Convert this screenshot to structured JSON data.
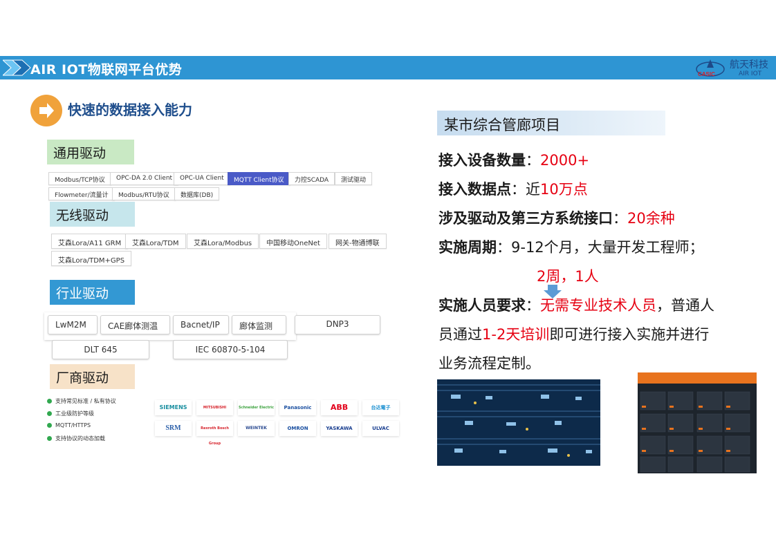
{
  "header": {
    "title": "AIR IOT物联网平台优势",
    "logo_cn": "航天科技",
    "logo_en": "AIR IOT",
    "logo_mark": "CASIC"
  },
  "section": {
    "title": "快速的数据接入能力"
  },
  "general": {
    "title": "通用驱动",
    "tags": [
      "Modbus/TCP协议",
      "OPC-DA 2.0 Client",
      "OPC-UA Client",
      "MQTT Client协议",
      "力控SCADA",
      "测试驱动",
      "Flowmeter/流量计",
      "Modbus/RTU协议",
      "数据库(DB)"
    ]
  },
  "wireless": {
    "title": "无线驱动",
    "tags": [
      "艾森Lora/A11 GRM",
      "艾森Lora/TDM",
      "艾森Lora/Modbus",
      "中国移动OneNet",
      "网关-物通博联",
      "艾森Lora/TDM+GPS"
    ]
  },
  "industry": {
    "title": "行业驱动",
    "tags": [
      "LwM2M",
      "CAE廊体测温",
      "Bacnet/IP",
      "廊体监测",
      "DNP3",
      "DLT 645",
      "IEC 60870-5-104"
    ]
  },
  "vendor": {
    "title": "厂商驱动",
    "features": [
      "支持常见标准 / 私有协议",
      "工业级防护等级",
      "MQTT/HTTPS",
      "支持协议的动态加载"
    ],
    "brands": [
      "SIEMENS",
      "MITSUBISHI ELECTRIC",
      "Schneider Electric",
      "Panasonic",
      "ABB",
      "台达電子",
      "SRM",
      "Rexroth Bosch Group",
      "WEINTEK",
      "OMRON",
      "YASKAWA",
      "ULVAC"
    ]
  },
  "project": {
    "title": "某市综合管廊项目",
    "devices_label": "接入设备数量",
    "devices_value": "2000+",
    "points_label": "接入数据点",
    "points_prefix": "近",
    "points_value": "10万点",
    "drivers_label": "涉及驱动及第三方系统接口",
    "drivers_value": "20余种",
    "period_label": "实施周期",
    "period_value": "9-12个月，大量开发工程师；",
    "period_new": "2周，1人",
    "staff_label": "实施人员要求",
    "staff_red": "无需专业技术人员",
    "staff_rest": "，普通人",
    "line2_a": "员通过",
    "line2_red": "1-2天培训",
    "line2_b": "即可进行接入实施并进行",
    "line3": "业务流程定制。"
  },
  "colors": {
    "header": "#2e95d3",
    "accent_orange": "#f0a23b",
    "red": "#e60012",
    "selected_tag": "#4a5ac7"
  }
}
